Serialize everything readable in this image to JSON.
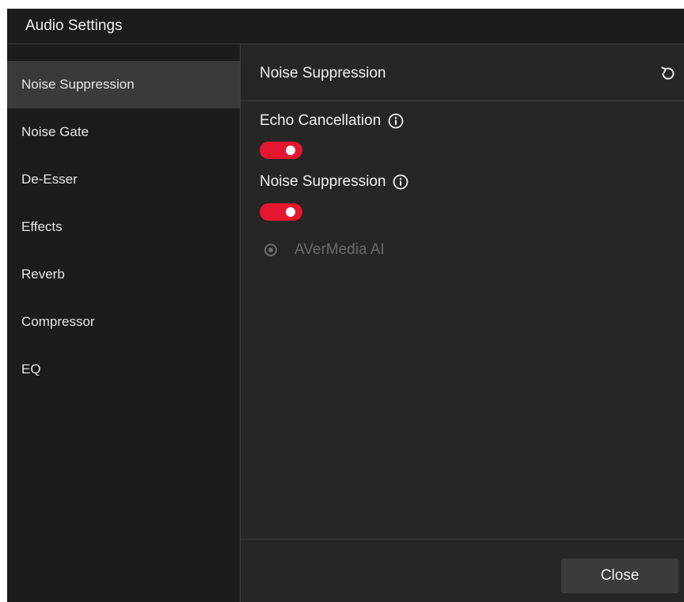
{
  "window": {
    "title": "Audio Settings"
  },
  "sidebar": {
    "items": [
      {
        "label": "Noise Suppression",
        "active": true
      },
      {
        "label": "Noise Gate",
        "active": false
      },
      {
        "label": "De-Esser",
        "active": false
      },
      {
        "label": "Effects",
        "active": false
      },
      {
        "label": "Reverb",
        "active": false
      },
      {
        "label": "Compressor",
        "active": false
      },
      {
        "label": "EQ",
        "active": false
      }
    ]
  },
  "content": {
    "header_title": "Noise Suppression",
    "reset_icon": "reset-icon",
    "settings": {
      "echo_cancellation": {
        "label": "Echo Cancellation",
        "enabled": true,
        "info_icon": "info-icon"
      },
      "noise_suppression": {
        "label": "Noise Suppression",
        "enabled": true,
        "info_icon": "info-icon"
      },
      "engine_option": {
        "label": "AVerMedia AI",
        "selected": true,
        "disabled": true
      }
    }
  },
  "footer": {
    "close_label": "Close"
  },
  "colors": {
    "accent_toggle": "#e5162f",
    "sidebar_bg": "#1c1c1c",
    "content_bg": "#262626",
    "active_item_bg": "#3a3a3a"
  }
}
